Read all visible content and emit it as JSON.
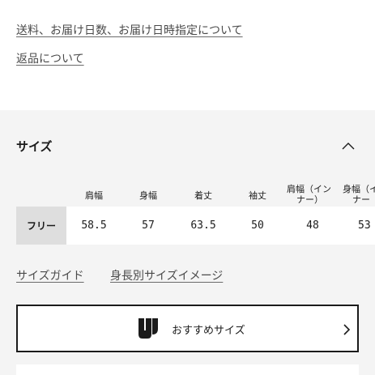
{
  "links": {
    "shipping": "送料、お届け日数、お届け日時指定について",
    "returns": "返品について"
  },
  "size_section": {
    "heading": "サイズ",
    "collapse_icon": "chevron-up-icon",
    "columns": [
      "肩幅",
      "身幅",
      "着丈",
      "袖丈",
      "肩幅（イン",
      "ナー）",
      "身幅（イ",
      "ナー"
    ],
    "row_label": "フリー",
    "values": [
      "58.5",
      "57",
      "63.5",
      "50",
      "48",
      "53"
    ],
    "size_guide": "サイズガイド",
    "height_image": "身長別サイズイメージ",
    "recommend_button": "おすすめサイズ",
    "recommend_icon": "brand-logo-icon",
    "arrow_icon": "chevron-right-icon"
  },
  "colors": {
    "section_bg": "#f4f4f4",
    "row_label_bg": "#dedede",
    "text": "#1b1b1b",
    "link": "#4a4a4a"
  }
}
